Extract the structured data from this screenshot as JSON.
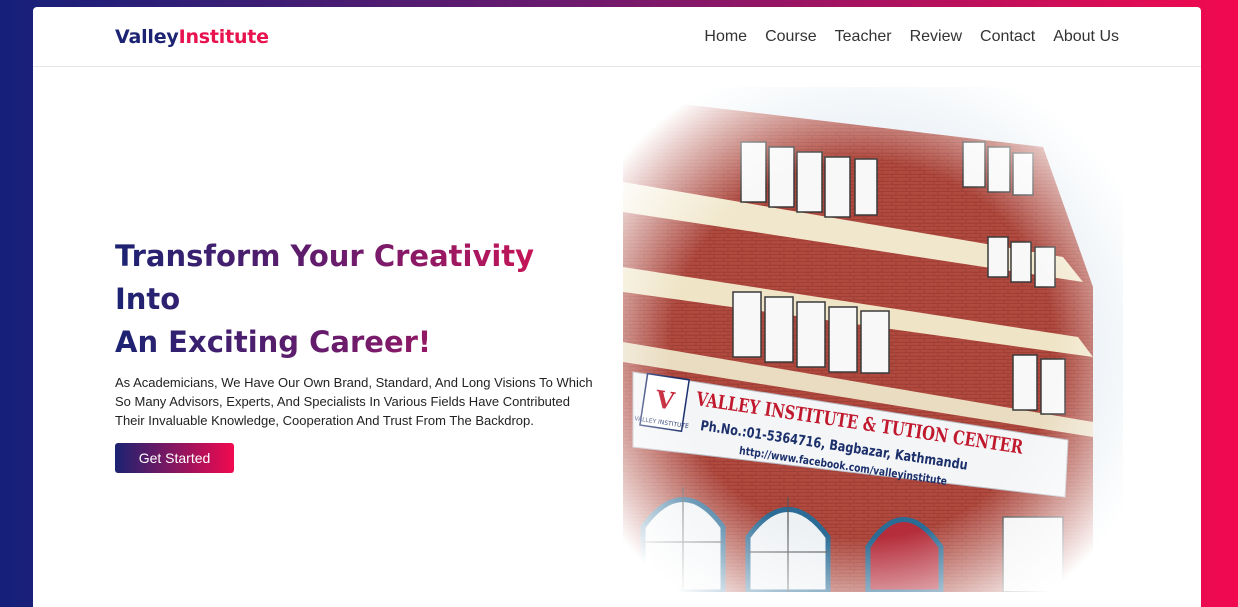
{
  "brand": {
    "part1": "Valley",
    "part2": "Institute"
  },
  "nav": [
    "Home",
    "Course",
    "Teacher",
    "Review",
    "Contact",
    "About Us"
  ],
  "hero": {
    "headline_line1": "Transform Your Creativity Into",
    "headline_line2": "An Exciting Career!",
    "description": "As Academicians, We Have Our Own Brand, Standard, And Long Visions To Which So Many Advisors, Experts, And Specialists In Various Fields Have Contributed Their Invaluable Knowledge, Cooperation And Trust From The Backdrop.",
    "cta": "Get Started"
  },
  "photo": {
    "sign_title": "VALLEY INSTITUTE & TUTION CENTER",
    "sign_phone": "Ph.No.:01-5364716, Bagbazar, Kathmandu",
    "sign_url": "http://www.facebook.com/valleyinstitute",
    "logo_letter": "V",
    "logo_caption": "VALLEY INSTITUTE"
  },
  "colors": {
    "brand_dark": "#1b2372",
    "brand_accent": "#e8124f"
  }
}
